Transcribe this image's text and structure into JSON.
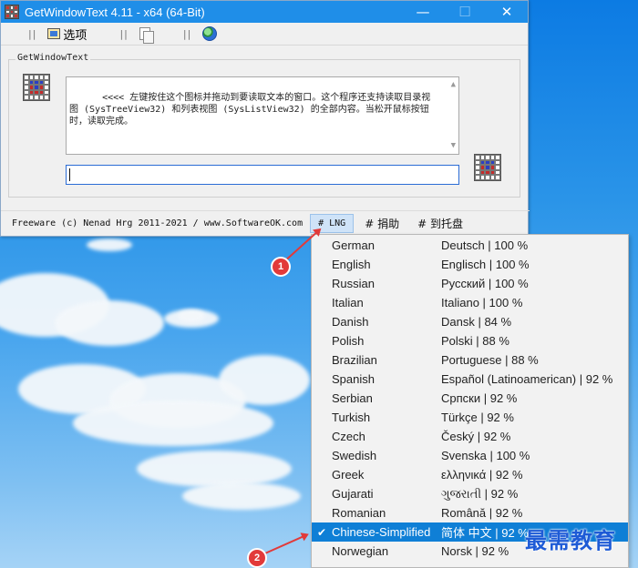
{
  "window": {
    "title": "GetWindowText 4.11 - x64 (64-Bit)",
    "minimize_glyph": "—",
    "maximize_glyph": "☐",
    "close_glyph": "✕"
  },
  "toolbar": {
    "separator": "||",
    "options_label": "选项",
    "copy_icon": "copy-icon",
    "web_icon": "globe-icon"
  },
  "main": {
    "group_label": "GetWindowText",
    "instructions": "<<<< 左键按住这个图标并拖动到要读取文本的窗口。这个程序还支持读取目录视图 (SysTreeView32) 和列表视图 (SysListView32) 的全部内容。当松开鼠标按钮时，读取完成。",
    "input_value": ""
  },
  "status": {
    "freeware": "Freeware (c) Nenad Hrg 2011-2021 / www.SoftwareOK.com",
    "lng": "# LNG",
    "donate": "# 捐助",
    "tray": "# 到托盘"
  },
  "languages": [
    {
      "name": "German",
      "native": "Deutsch | 100 %"
    },
    {
      "name": "English",
      "native": "Englisch | 100 %"
    },
    {
      "name": "Russian",
      "native": "Русский | 100 %"
    },
    {
      "name": "Italian",
      "native": "Italiano | 100 %"
    },
    {
      "name": "Danish",
      "native": "Dansk | 84 %"
    },
    {
      "name": "Polish",
      "native": "Polski | 88 %"
    },
    {
      "name": "Brazilian",
      "native": "Portuguese | 88 %"
    },
    {
      "name": "Spanish",
      "native": "Español (Latinoamerican) | 92 %"
    },
    {
      "name": "Serbian",
      "native": "Српски | 92 %"
    },
    {
      "name": "Turkish",
      "native": "Türkçe | 92 %"
    },
    {
      "name": "Czech",
      "native": "Český | 92 %"
    },
    {
      "name": "Swedish",
      "native": "Svenska | 100 %"
    },
    {
      "name": "Greek",
      "native": "ελληνικά | 92 %"
    },
    {
      "name": "Gujarati",
      "native": "ગુજરાતી | 92 %"
    },
    {
      "name": "Romanian",
      "native": "Română | 92 %"
    },
    {
      "name": "Chinese-Simplified",
      "native": "简体 中文 | 92 %",
      "selected": true,
      "check": "✔"
    },
    {
      "name": "Norwegian",
      "native": "Norsk | 92 %"
    }
  ],
  "annotations": {
    "badge1": "1",
    "badge2": "2",
    "color": "#e23a3a"
  },
  "watermark": "最需教育",
  "colors": {
    "titlebar": "#1f8ee8",
    "selection": "#0f7fd6",
    "window_bg": "#f0f0f0"
  }
}
